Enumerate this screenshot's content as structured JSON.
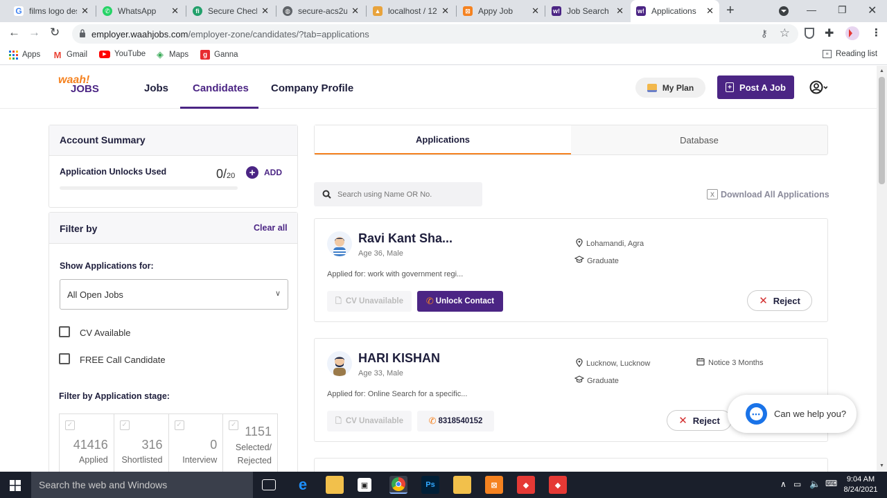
{
  "browser": {
    "tabs": [
      {
        "title": "films logo des",
        "favicon": "google-icon",
        "color": "#4285f4"
      },
      {
        "title": "WhatsApp",
        "favicon": "whatsapp-icon",
        "color": "#25d366"
      },
      {
        "title": "Secure Check",
        "favicon": "secure-check-icon",
        "color": "#22a06b"
      },
      {
        "title": "secure-acs2u",
        "favicon": "globe-icon",
        "color": "#5f6368"
      },
      {
        "title": "localhost / 12",
        "favicon": "phpmyadmin-icon",
        "color": "#e8a33c"
      },
      {
        "title": "Appy Job",
        "favicon": "appyjob-icon",
        "color": "#f58220"
      },
      {
        "title": "Job Search In",
        "favicon": "waahjobs-icon",
        "color": "#4b2584"
      },
      {
        "title": "Applications",
        "favicon": "waahjobs-icon",
        "color": "#4b2584"
      }
    ],
    "new_tab": "+",
    "url_host": "employer.waahjobs.com",
    "url_path": "/employer-zone/candidates/?tab=applications",
    "bookmarks": [
      {
        "label": "Apps",
        "icon": "apps-grid-icon"
      },
      {
        "label": "Gmail",
        "icon": "gmail-icon"
      },
      {
        "label": "YouTube",
        "icon": "youtube-icon"
      },
      {
        "label": "Maps",
        "icon": "maps-icon"
      },
      {
        "label": "Ganna",
        "icon": "ganna-icon"
      }
    ],
    "reading_list": "Reading list"
  },
  "header": {
    "logo_top": "waah!",
    "logo_bottom": "JOBS",
    "nav": [
      "Jobs",
      "Candidates",
      "Company Profile"
    ],
    "active_nav": "Candidates",
    "my_plan": "My Plan",
    "post_job": "Post A Job",
    "accent": "#4b2584",
    "orange": "#f58220"
  },
  "sidebar": {
    "account_title": "Account Summary",
    "unlocks_label": "Application Unlocks Used",
    "unlocks_used": "0",
    "unlocks_total": "20",
    "unlocks_fraction": 0,
    "add_label": "ADD",
    "filter_title": "Filter by",
    "clear_all": "Clear all",
    "show_for_label": "Show Applications for:",
    "show_for_value": "All Open Jobs",
    "checkboxes": [
      "CV Available",
      "FREE Call Candidate"
    ],
    "stage_title": "Filter by Application stage:",
    "stages": [
      {
        "count": "41416",
        "label": "Applied"
      },
      {
        "count": "316",
        "label": "Shortlisted"
      },
      {
        "count": "0",
        "label": "Interview"
      },
      {
        "count": "1151",
        "label": "Selected/\nRejected"
      }
    ]
  },
  "main": {
    "tabs": [
      "Applications",
      "Database"
    ],
    "active_tab": "Applications",
    "search_placeholder": "Search using Name OR No.",
    "download_label": "Download All Applications",
    "candidates": [
      {
        "name": "Ravi Kant Sha...",
        "meta": "Age 36, Male",
        "location": "Lohamandi, Agra",
        "education": "Graduate",
        "notice": "",
        "applied_for": "Applied for: work with government regi...",
        "cv": "CV Unavailable",
        "contact": "Unlock Contact",
        "reject": "Reject"
      },
      {
        "name": "HARI KISHAN",
        "meta": "Age 33, Male",
        "location": "Lucknow, Lucknow",
        "education": "Graduate",
        "notice": "Notice 3 Months",
        "applied_for": "Applied for: Online Search for a specific...",
        "cv": "CV Unavailable",
        "contact": "8318540152",
        "reject": "Reject"
      }
    ],
    "chat_label": "Can we help you?"
  },
  "taskbar": {
    "search_placeholder": "Search the web and Windows",
    "time": "9:04 AM",
    "date": "8/24/2021"
  }
}
